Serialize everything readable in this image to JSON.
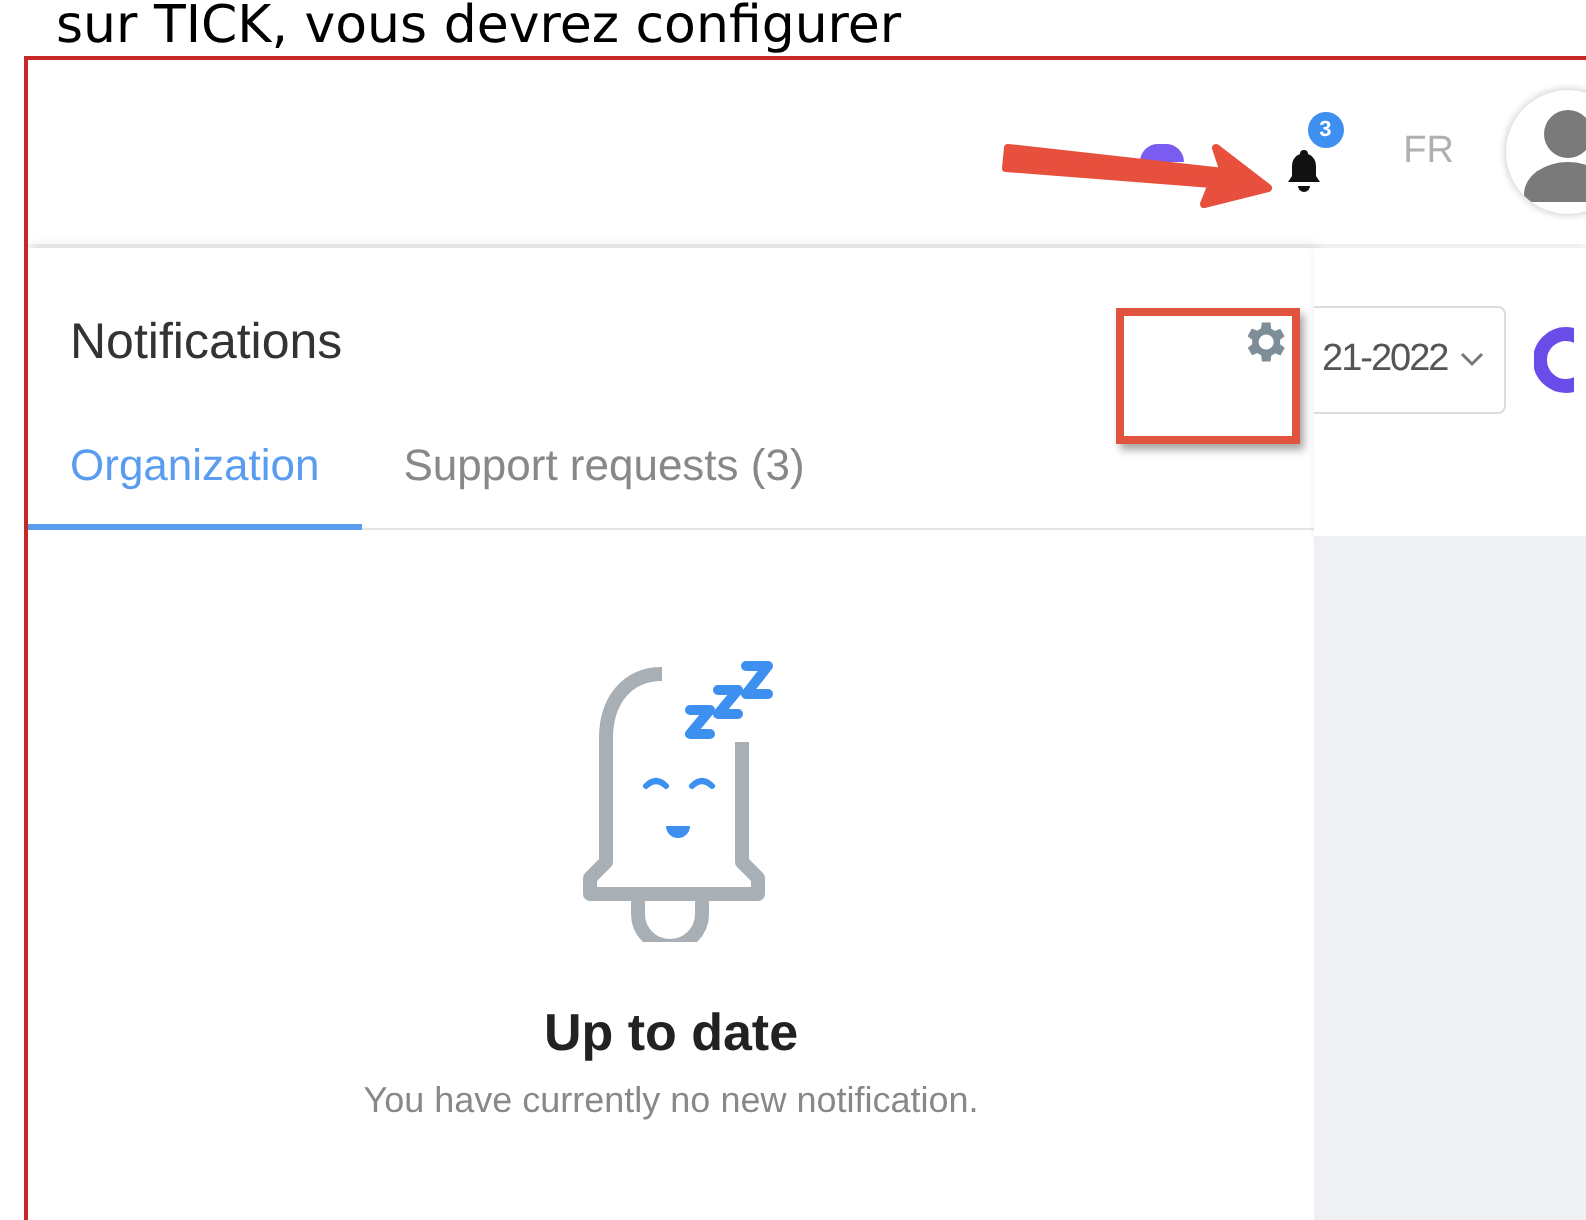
{
  "document_text": "sur TICK, vous devrez configurer",
  "top_bar": {
    "notification_badge": "3",
    "language": "FR"
  },
  "panel": {
    "title": "Notifications",
    "tabs": [
      {
        "label": "Organization",
        "selected": true
      },
      {
        "label": "Support requests (3)",
        "selected": false
      }
    ],
    "empty_state": {
      "title": "Up to date",
      "message": "You have currently no new notification."
    }
  },
  "year_selector": {
    "value": "21-2022"
  }
}
